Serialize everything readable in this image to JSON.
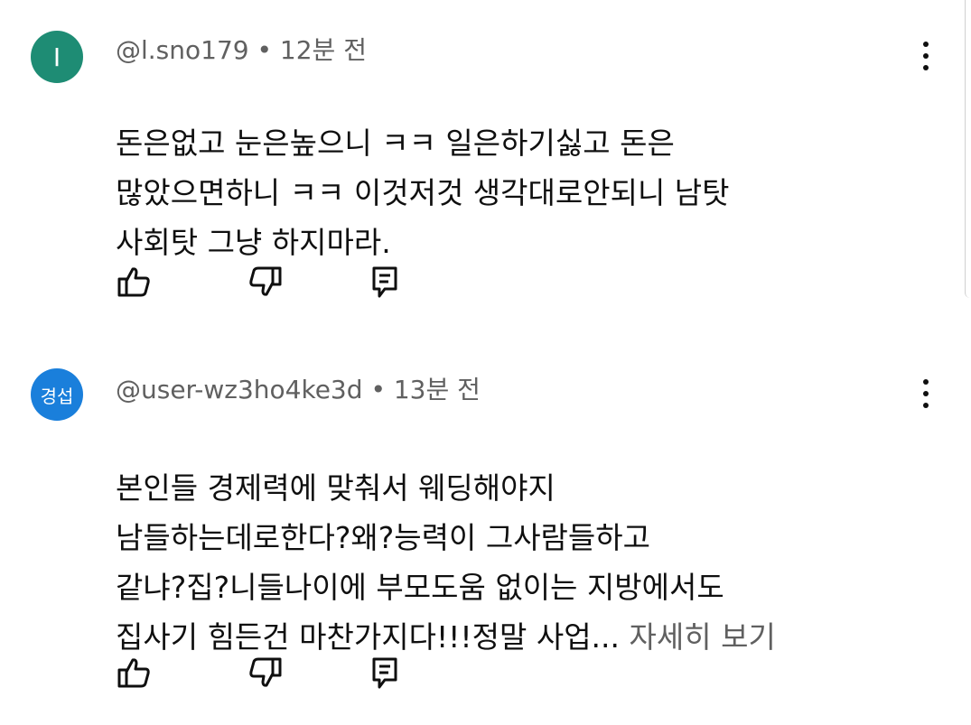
{
  "comments": [
    {
      "avatar_letter": "I",
      "avatar_color": "#1e8c74",
      "author": "@l.sno179",
      "time": "12분 전",
      "text": "돈은없고 눈은높으니 ㅋㅋ 일은하기싫고 돈은\n많았으면하니 ㅋㅋ 이것저것 생각대로안되니 남탓\n사회탓 그냥 하지마라.",
      "more_label": ""
    },
    {
      "avatar_letter": "경섭",
      "avatar_color": "#1a7fdb",
      "author": "@user-wz3ho4ke3d",
      "time": "13분 전",
      "text": "본인들 경제력에 맞춰서 웨딩해야지\n남들하는데로한다?왜?능력이 그사람들하고\n같냐?집?니들나이에 부모도움 없이는 지방에서도\n집사기 힘든건 마찬가지다!!!정말 사업... ",
      "more_label": "자세히 보기"
    }
  ],
  "icons": {
    "like": "thumb-up-icon",
    "dislike": "thumb-down-icon",
    "reply": "reply-icon",
    "menu": "more-vert-icon"
  }
}
